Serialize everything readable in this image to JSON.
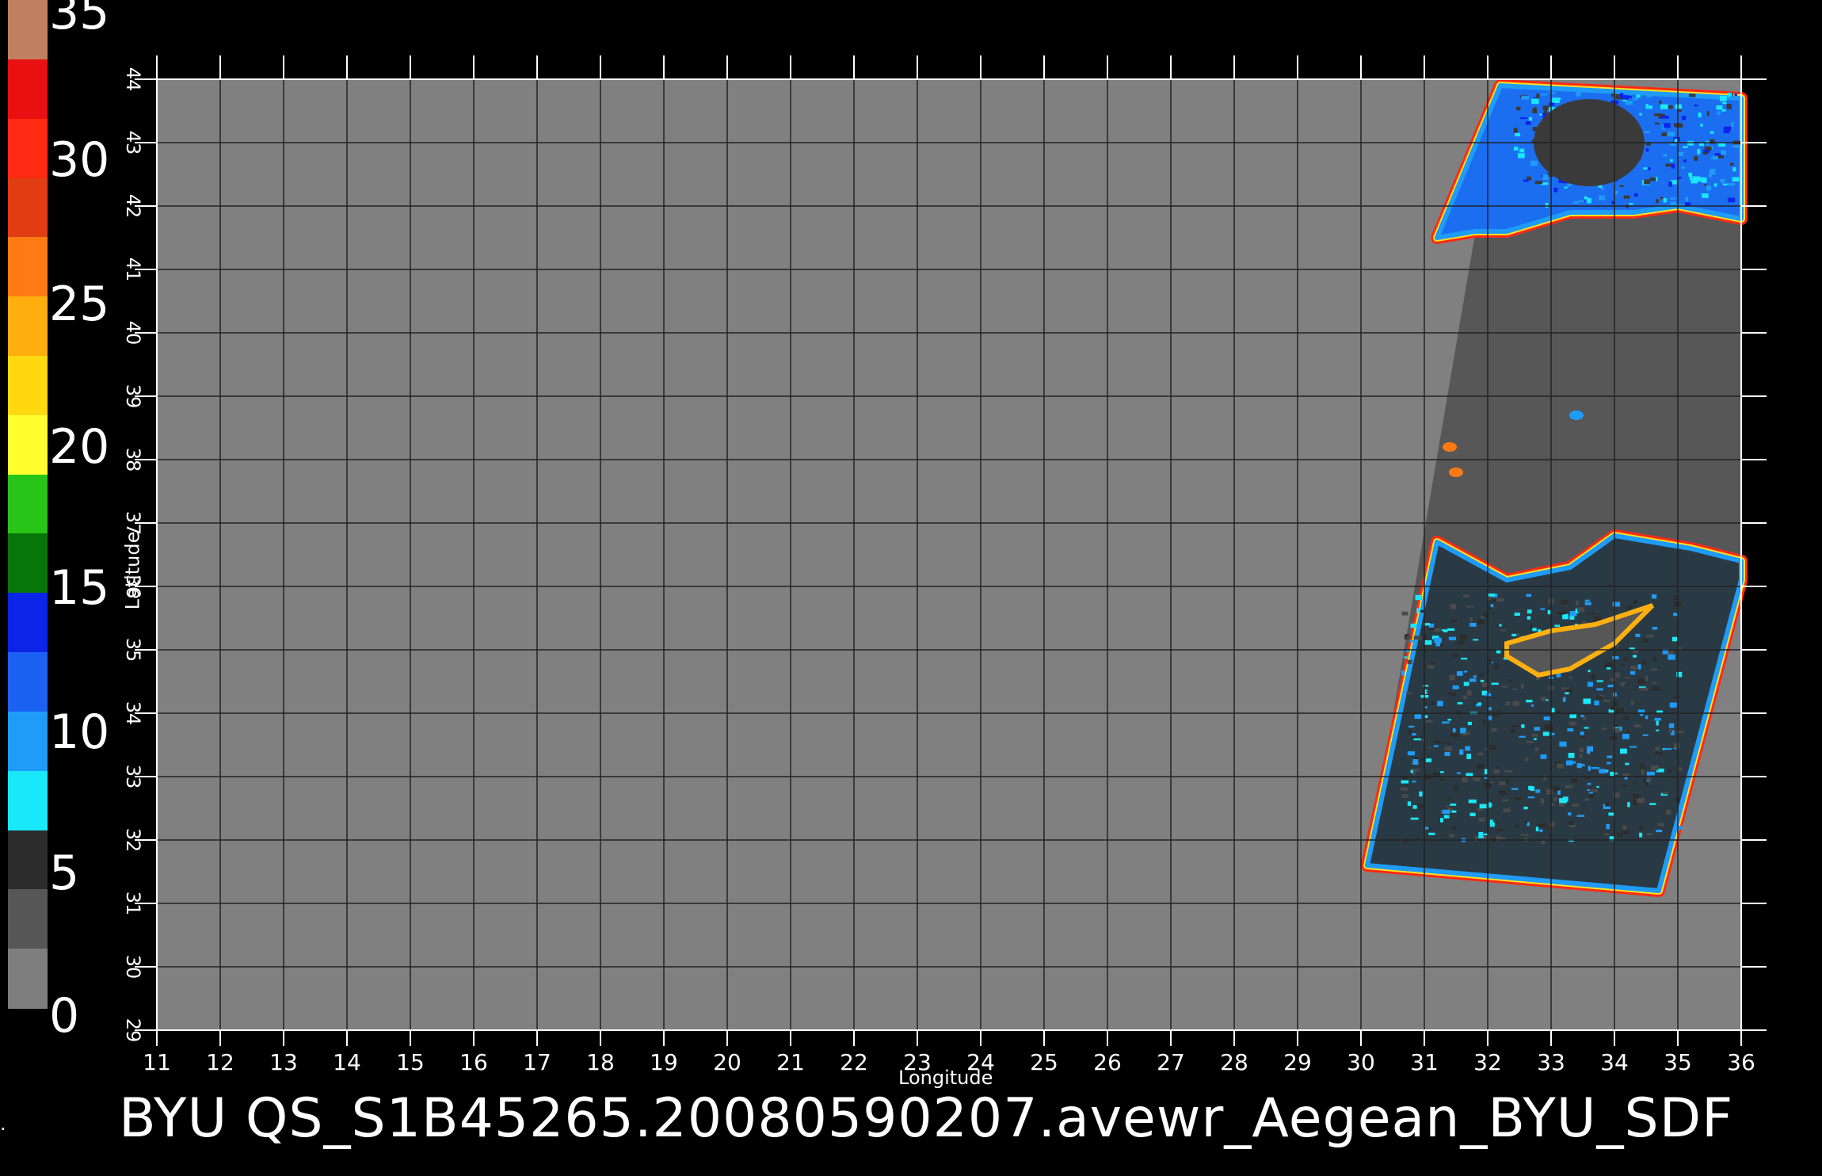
{
  "caption": "BYU  QS_S1B45265.20080590207.avewr_Aegean_BYU_SDF",
  "edge_mark": ".",
  "colorbar": {
    "labels": [
      "35",
      "30",
      "25",
      "20",
      "15",
      "10",
      "5",
      "0"
    ],
    "bands": [
      {
        "color": "#c08060"
      },
      {
        "color": "#e81010"
      },
      {
        "color": "#ff2a12"
      },
      {
        "color": "#e03e12"
      },
      {
        "color": "#ff7a12"
      },
      {
        "color": "#ffae10"
      },
      {
        "color": "#ffd810"
      },
      {
        "color": "#ffff30"
      },
      {
        "color": "#28c418"
      },
      {
        "color": "#07760a"
      },
      {
        "color": "#0c24e8"
      },
      {
        "color": "#1c62f2"
      },
      {
        "color": "#1e9cf8"
      },
      {
        "color": "#18e8fa"
      },
      {
        "color": "#2c2c2c"
      },
      {
        "color": "#565656"
      },
      {
        "color": "#7e7e7e"
      }
    ]
  },
  "axes": {
    "xlabel": "Longitude",
    "ylabel": "Latitude",
    "lon_range": [
      11,
      36
    ],
    "lat_range": [
      29,
      44
    ],
    "lon_ticks": [
      "11",
      "12",
      "13",
      "14",
      "15",
      "16",
      "17",
      "18",
      "19",
      "20",
      "21",
      "22",
      "23",
      "24",
      "25",
      "26",
      "27",
      "28",
      "29",
      "30",
      "31",
      "32",
      "33",
      "34",
      "35",
      "36"
    ],
    "lat_ticks": [
      "29",
      "30",
      "31",
      "32",
      "33",
      "34",
      "35",
      "36",
      "37",
      "38",
      "39",
      "40",
      "41",
      "42",
      "43",
      "44"
    ]
  },
  "colors": {
    "background": "#000000",
    "land_fill": "#808080",
    "swath_fill": "#575757",
    "grid": "#222222",
    "frame": "#ffffff"
  },
  "swath": {
    "corners_lonlat": [
      [
        32.2,
        43.9
      ],
      [
        36.0,
        43.7
      ],
      [
        36.0,
        36.1
      ],
      [
        34.7,
        31.2
      ],
      [
        30.1,
        31.6
      ],
      [
        32.2,
        43.9
      ]
    ],
    "black_sea_lonlat": [
      [
        32.2,
        43.9
      ],
      [
        36.0,
        43.7
      ],
      [
        36.0,
        41.8
      ],
      [
        35.0,
        42.0
      ],
      [
        34.3,
        41.9
      ],
      [
        33.3,
        41.9
      ],
      [
        32.3,
        41.6
      ],
      [
        31.8,
        41.6
      ],
      [
        31.2,
        41.5
      ],
      [
        32.2,
        43.9
      ]
    ],
    "med_lonlat": [
      [
        31.2,
        36.7
      ],
      [
        32.3,
        36.1
      ],
      [
        33.3,
        36.3
      ],
      [
        34.0,
        36.8
      ],
      [
        35.2,
        36.6
      ],
      [
        36.0,
        36.4
      ],
      [
        36.0,
        36.1
      ],
      [
        34.7,
        31.2
      ],
      [
        30.1,
        31.6
      ],
      [
        31.2,
        36.7
      ]
    ],
    "cyprus_lonlat": [
      [
        32.3,
        35.1
      ],
      [
        33.0,
        35.3
      ],
      [
        33.7,
        35.4
      ],
      [
        34.6,
        35.7
      ],
      [
        34.0,
        35.1
      ],
      [
        33.3,
        34.7
      ],
      [
        32.8,
        34.6
      ],
      [
        32.3,
        34.9
      ]
    ],
    "lake_spots_lonlat": [
      [
        33.4,
        38.7
      ],
      [
        31.4,
        38.2
      ],
      [
        31.5,
        37.8
      ]
    ]
  }
}
